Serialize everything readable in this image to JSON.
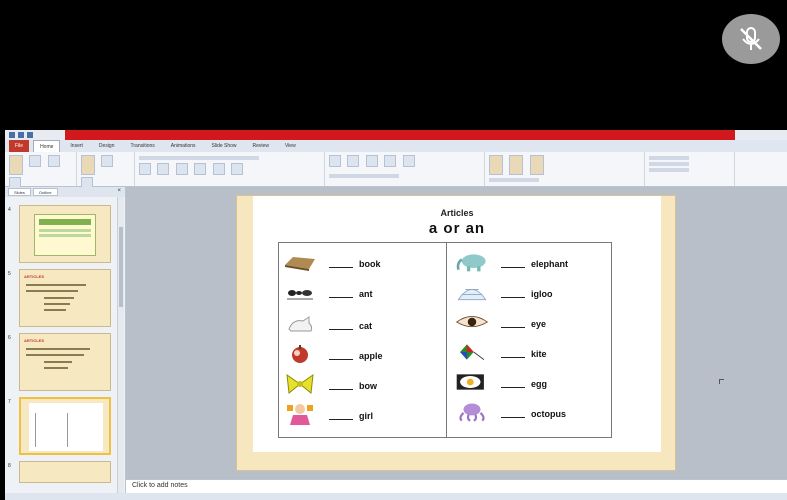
{
  "app": {
    "title": ""
  },
  "ribbon": {
    "tabs": [
      "File",
      "Home",
      "Insert",
      "Design",
      "Transitions",
      "Animations",
      "Slide Show",
      "Review",
      "View"
    ]
  },
  "pane": {
    "tabs": [
      "Slides",
      "Outline"
    ],
    "close_glyph": "×",
    "thumbnails": [
      {
        "number": "4",
        "title": ""
      },
      {
        "number": "5",
        "title": "ARTICLES"
      },
      {
        "number": "6",
        "title": "ARTICLES"
      },
      {
        "number": "7",
        "title": ""
      },
      {
        "number": "8",
        "title": ""
      }
    ]
  },
  "slide": {
    "title": "Articles",
    "subtitle": "a or an",
    "left_items": [
      "book",
      "ant",
      "cat",
      "apple",
      "bow",
      "girl"
    ],
    "right_items": [
      "elephant",
      "igloo",
      "eye",
      "kite",
      "egg",
      "octopus"
    ]
  },
  "notes": {
    "placeholder": "Click to add notes"
  },
  "colors": {
    "title_bar": "#d0181d",
    "slide_border": "#f7e7bf",
    "overlay_button": "#9a9a9a"
  },
  "icons": {
    "mic_muted": "mic-off-icon"
  }
}
